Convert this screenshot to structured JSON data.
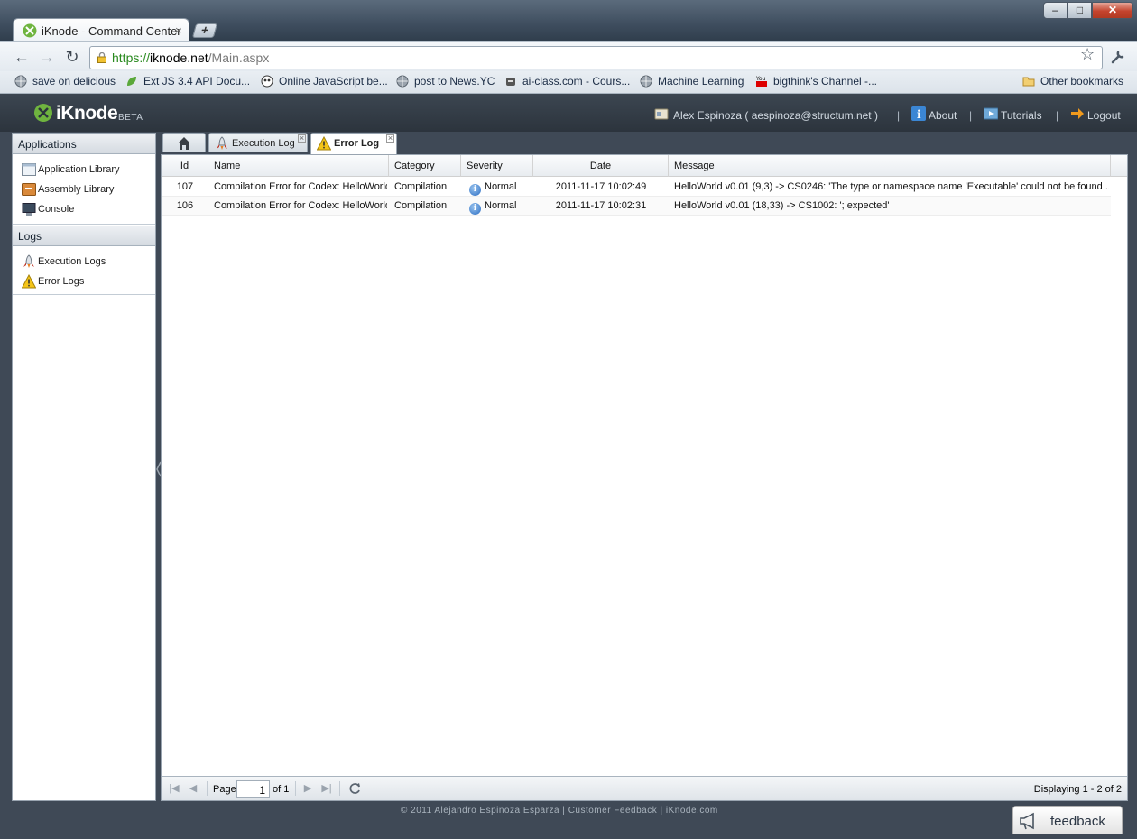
{
  "browser": {
    "tab_title": "iKnode - Command Center",
    "tab_close": "×",
    "new_tab": "+",
    "window_min": "–",
    "window_max": "□",
    "window_close": "✕",
    "url_protocol": "https://",
    "url_host": "iknode.net",
    "url_path": "/Main.aspx",
    "bookmarks": [
      {
        "label": "save on delicious",
        "icon": "globe-icon"
      },
      {
        "label": "Ext JS 3.4 API Docu...",
        "icon": "leaf-icon"
      },
      {
        "label": "Online JavaScript be...",
        "icon": "owl-icon"
      },
      {
        "label": "post to News.YC",
        "icon": "globe-icon"
      },
      {
        "label": "ai-class.com - Cours...",
        "icon": "robot-icon"
      },
      {
        "label": "Machine Learning",
        "icon": "globe-icon"
      },
      {
        "label": "bigthink's Channel -...",
        "icon": "youtube-icon"
      }
    ],
    "other_bookmarks": "Other bookmarks"
  },
  "header": {
    "logo_name": "iKnode",
    "logo_beta": "BETA",
    "user": "Alex Espinoza ( aespinoza@structum.net )",
    "about": "About",
    "tutorials": "Tutorials",
    "logout": "Logout",
    "separator": "|"
  },
  "sidebar": {
    "groups": [
      {
        "title": "Applications",
        "items": [
          {
            "label": "Application Library",
            "icon": "application-window-icon"
          },
          {
            "label": "Assembly Library",
            "icon": "assembly-box-icon"
          },
          {
            "label": "Console",
            "icon": "monitor-icon"
          }
        ]
      },
      {
        "title": "Logs",
        "items": [
          {
            "label": "Execution Logs",
            "icon": "rocket-icon"
          },
          {
            "label": "Error Logs",
            "icon": "warning-icon"
          }
        ]
      }
    ]
  },
  "tabs": [
    {
      "label": "",
      "icon": "home-icon"
    },
    {
      "label": "Execution Log",
      "icon": "rocket-icon"
    },
    {
      "label": "Error Log",
      "icon": "warning-icon",
      "active": true
    }
  ],
  "grid": {
    "columns": [
      "Id",
      "Name",
      "Category",
      "Severity",
      "Date",
      "Message"
    ],
    "rows": [
      {
        "id": "107",
        "name": "Compilation Error for Codex: HelloWorld",
        "category": "Compilation",
        "severity": "Normal",
        "date": "2011-11-17 10:02:49",
        "message": "HelloWorld v0.01 (9,3) -> CS0246: 'The type or namespace name 'Executable' could not be found ..."
      },
      {
        "id": "106",
        "name": "Compilation Error for Codex: HelloWorld",
        "category": "Compilation",
        "severity": "Normal",
        "date": "2011-11-17 10:02:31",
        "message": "HelloWorld v0.01 (18,33) -> CS1002: '; expected'"
      }
    ]
  },
  "pager": {
    "page_label": "Page",
    "page_value": "1",
    "of_label": "of 1",
    "display": "Displaying 1 - 2 of 2"
  },
  "footer": {
    "copyright": "© 2011 Alejandro Espinoza Esparza",
    "sep": "|",
    "customer_feedback": "Customer Feedback",
    "site": "iKnode.com",
    "feedback_button": "feedback"
  }
}
